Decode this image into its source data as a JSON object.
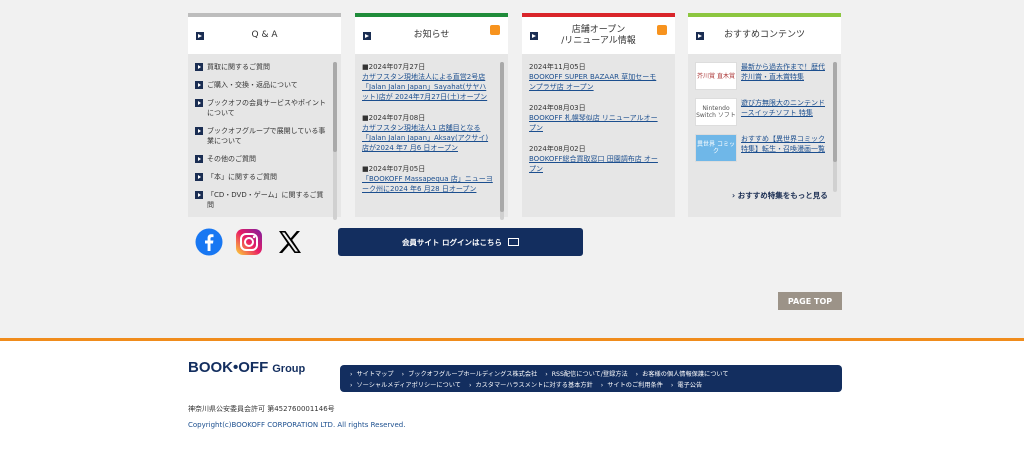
{
  "columns": {
    "qa": {
      "title": "Q & A",
      "items": [
        "買取に関するご質問",
        "ご購入・交換・返品について",
        "ブックオフの会員サービスやポイントについて",
        "ブックオフグループで展開している事業について",
        "その他のご質問",
        "「本」に関するご質問",
        "「CD・DVD・ゲーム」に関するご質問"
      ]
    },
    "news": {
      "title": "お知らせ",
      "items": [
        {
          "date": "■2024年07月27日",
          "text": "カザフスタン現地法人による直営2号店「Jalan Jalan Japan」Sayahat(サヤハット)店が 2024年7月27日(土)オープン"
        },
        {
          "date": "■2024年07月08日",
          "text": "カザフスタン現地法人1 店舗目となる「Jalan Jalan Japan」Aksay(アクサイ)店が2024 年7 月6 日オープン"
        },
        {
          "date": "■2024年07月05日",
          "text": "「BOOKOFF Massapequa 店」ニューヨーク州に2024 年6 月28 日オープン"
        }
      ]
    },
    "stores": {
      "title_line1": "店舗オープン",
      "title_line2": "/リニューアル情報",
      "items": [
        {
          "date": "2024年11月05日",
          "text": "BOOKOFF SUPER BAZAAR 草加セーモンプラザ店 オープン"
        },
        {
          "date": "2024年08月03日",
          "text": "BOOKOFF 札幌琴似店 リニューアルオープン"
        },
        {
          "date": "2024年08月02日",
          "text": "BOOKOFF総合買取窓口 田園調布店 オープン"
        }
      ]
    },
    "recommend": {
      "title": "おすすめコンテンツ",
      "items": [
        {
          "thumb": "芥川賞 直木賞",
          "text": "最新から過去作まで！歴代芥川賞・直木賞特集"
        },
        {
          "thumb": "Nintendo Switch ソフト",
          "text": "遊び方無限大のニンテンドースイッチソフト 特集"
        },
        {
          "thumb": "異世界 コミック",
          "text": "おすすめ【異世界コミック特集】転生・召喚漫画一覧"
        }
      ],
      "more": "おすすめ特集をもっと見る"
    }
  },
  "member_button": "会員サイト ログインはこちら",
  "page_top": "PAGE TOP",
  "footer": {
    "logo": "BOOK•OFF",
    "logo_group": "Group",
    "nav_row1": [
      "サイトマップ",
      "ブックオフグループホールディングス株式会社",
      "RSS配信について/登録方法",
      "お客様の個人情報保護について"
    ],
    "nav_row2": [
      "ソーシャルメディアポリシーについて",
      "カスタマーハラスメントに対する基本方針",
      "サイトのご利用条件",
      "電子公告"
    ],
    "permit": "神奈川県公安委員会許可 第452760001146号",
    "copyright": "Copyright(c)BOOKOFF CORPORATION LTD. All rights Reserved."
  },
  "colors": {
    "qa": "#bdbdbd",
    "news": "#1f8c3a",
    "stores": "#d9252a",
    "recommend": "#8cc63f",
    "navy": "#132e5f",
    "orange": "#f08c1c"
  }
}
